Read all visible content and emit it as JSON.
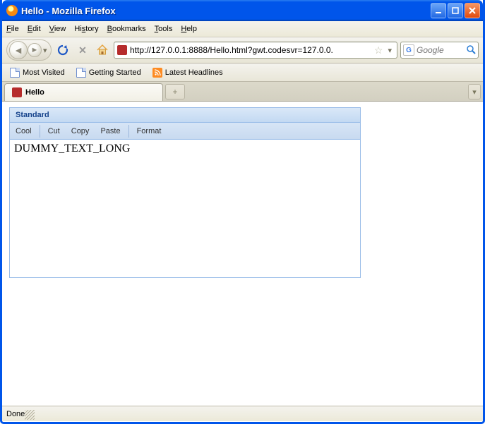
{
  "window": {
    "title": "Hello - Mozilla Firefox"
  },
  "menu": {
    "file": "File",
    "edit": "Edit",
    "view": "View",
    "history": "History",
    "bookmarks": "Bookmarks",
    "tools": "Tools",
    "help": "Help"
  },
  "url": "http://127.0.0.1:8888/Hello.html?gwt.codesvr=127.0.0.",
  "search": {
    "placeholder": "Google"
  },
  "bookmarks_bar": {
    "items": [
      "Most Visited",
      "Getting Started",
      "Latest Headlines"
    ]
  },
  "tab": {
    "title": "Hello"
  },
  "panel": {
    "title": "Standard",
    "toolbar": {
      "cool": "Cool",
      "cut": "Cut",
      "copy": "Copy",
      "paste": "Paste",
      "format": "Format"
    },
    "body": "DUMMY_TEXT_LONG"
  },
  "status": "Done"
}
